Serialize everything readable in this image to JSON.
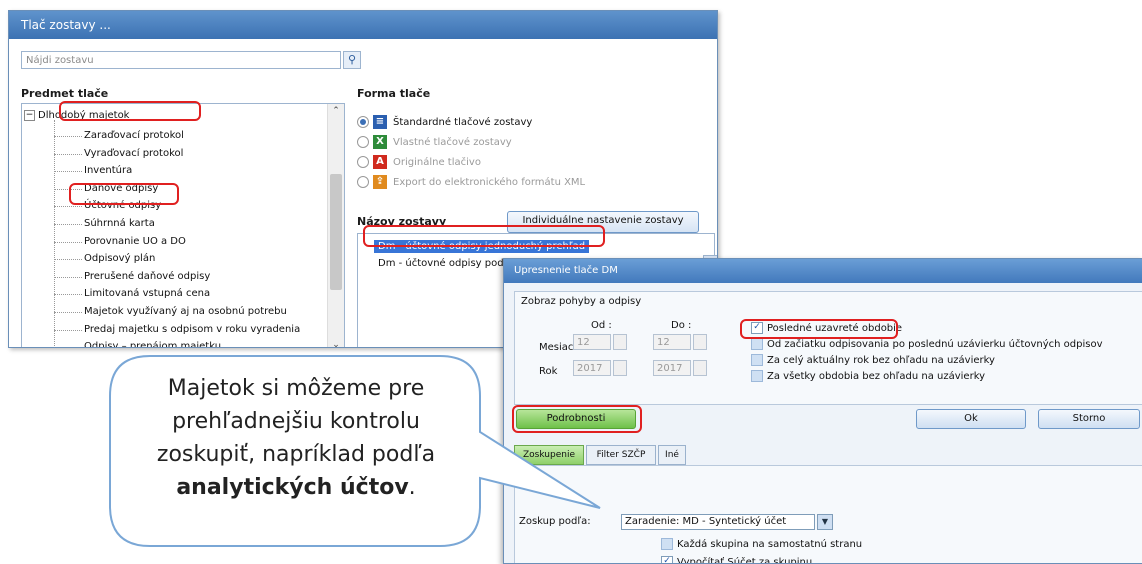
{
  "main_window": {
    "title": "Tlač zostavy ...",
    "search_placeholder": "Nájdi zostavu",
    "subject_title": "Predmet tlače",
    "tree_root": "Dlhodobý majetok",
    "tree_items": [
      "Zaraďovací protokol",
      "Vyraďovací protokol",
      "Inventúra",
      "Daňové odpisy",
      "Účtovné odpisy",
      "Súhrnná karta",
      "Porovnanie UO a DO",
      "Odpisový plán",
      "Prerušené daňové odpisy",
      "Limitovaná vstupná cena",
      "Majetok využívaný aj na osobnú potrebu",
      "Predaj majetku s odpisom v roku vyradenia",
      "Odpisy – prenájom majetku"
    ],
    "form_title": "Forma tlače",
    "form_options": [
      {
        "label": "Štandardné tlačové zostavy",
        "selected": true,
        "icon": "standard-report-icon",
        "color": "#2b5fb0"
      },
      {
        "label": "Vlastné tlačové zostavy",
        "selected": false,
        "icon": "excel-icon",
        "color": "#2e8b3a"
      },
      {
        "label": "Originálne tlačivo",
        "selected": false,
        "icon": "pdf-icon",
        "color": "#d02a1e"
      },
      {
        "label": "Export do elektronického formátu XML",
        "selected": false,
        "icon": "xml-export-icon",
        "color": "#e08a1e"
      }
    ],
    "report_name_title": "Názov zostavy",
    "individual_button": "Individuálne nastavenie zostavy",
    "reports": [
      "Dm - účtovné odpisy jednoduchý prehľad",
      "Dm - účtovné odpisy podrobne"
    ]
  },
  "dialog": {
    "title": "Upresnenie tlače DM",
    "group_title": "Zobraz pohyby a odpisy",
    "from_label": "Od :",
    "to_label": "Do :",
    "month_label": "Mesiac",
    "year_label": "Rok",
    "month_from": "12",
    "month_to": "12",
    "year_from": "2017",
    "year_to": "2017",
    "checks": [
      {
        "label": "Posledné uzavreté obdobie",
        "checked": true
      },
      {
        "label": "Od začiatku odpisovania po poslednú uzávierku účtovných odpisov",
        "checked": false
      },
      {
        "label": "Za celý aktuálny rok bez ohľadu na uzávierky",
        "checked": false
      },
      {
        "label": "Za všetky obdobia bez ohľadu na uzávierky",
        "checked": false
      }
    ],
    "details_button": "Podrobnosti",
    "ok_button": "Ok",
    "cancel_button": "Storno",
    "tabs": [
      "Zoskupenie",
      "Filter SZČP",
      "Iné"
    ],
    "group_by_label": "Zoskup podľa:",
    "group_by_value": "Zaradenie: MD - Syntetický účet",
    "group_checks": [
      {
        "label": "Každá skupina na samostatnú stranu",
        "checked": false
      },
      {
        "label": "Vypočítať Súčet za skupinu",
        "checked": true
      }
    ]
  },
  "callout": {
    "line1": "Majetok si môžeme  pre",
    "line2": "prehľadnejšiu kontrolu",
    "line3": "zoskupiť, napríklad podľa",
    "bold": "analytických účtov",
    "tail": "."
  },
  "colors": {
    "highlight": "#e02020",
    "callout_border": "#7aa7d6",
    "title_bar": "#3c72b3"
  }
}
